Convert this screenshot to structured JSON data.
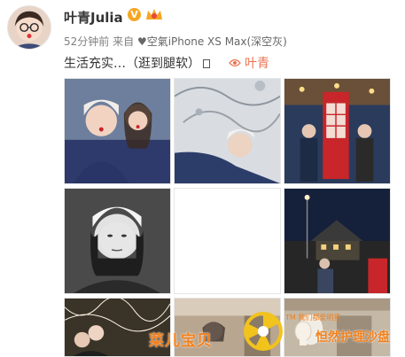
{
  "post": {
    "username": "叶青Julia",
    "vip_badge": "V",
    "time": "52分钟前",
    "source_prefix": "来自",
    "device": "空氣iPhone XS Max(深空灰)",
    "text": "生活充实…（逛到腿软）",
    "location": "叶青"
  },
  "images": [
    {
      "name": "photo-1",
      "palette": "#2d3a6b"
    },
    {
      "name": "photo-2",
      "palette": "#cfd5db"
    },
    {
      "name": "photo-3",
      "palette": "#c8262a"
    },
    {
      "name": "photo-4",
      "palette": "#8a8a8a"
    },
    {
      "name": "photo-5",
      "palette": "#ffffff"
    },
    {
      "name": "photo-6",
      "palette": "#15213a"
    },
    {
      "name": "photo-7",
      "palette": "#3a3328"
    },
    {
      "name": "photo-8",
      "palette": "#b8a690"
    },
    {
      "name": "photo-9",
      "palette": "#c4b8a6"
    }
  ],
  "watermark": {
    "left": "菜儿宝贝",
    "small": "TM 我们都爱明星",
    "right": "怛然护理沙盘"
  },
  "colors": {
    "link": "#eb7350",
    "watermark": "#f2811d",
    "meta": "#808080",
    "vip": "#f5a623"
  }
}
